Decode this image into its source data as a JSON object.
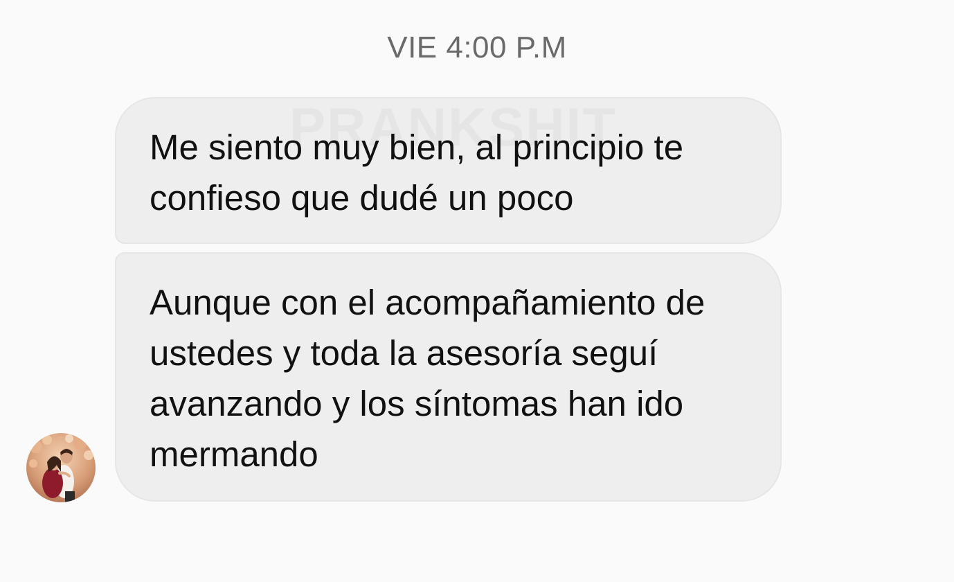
{
  "header": {
    "timestamp": "VIE 4:00 P.M"
  },
  "watermark": {
    "text": "PRANKSHIT"
  },
  "messages": [
    {
      "text": "Me siento muy bien, al principio te confieso que dudé un poco"
    },
    {
      "text": "Aunque con el acompañamiento de ustedes y toda la asesoría seguí avanzando y los síntomas han ido mermando"
    }
  ],
  "avatar": {
    "icon": "couple-photo-avatar"
  },
  "colors": {
    "background": "#fafafa",
    "bubble": "#eeeeee",
    "text": "#111111",
    "timestamp": "#6a6a6a"
  }
}
